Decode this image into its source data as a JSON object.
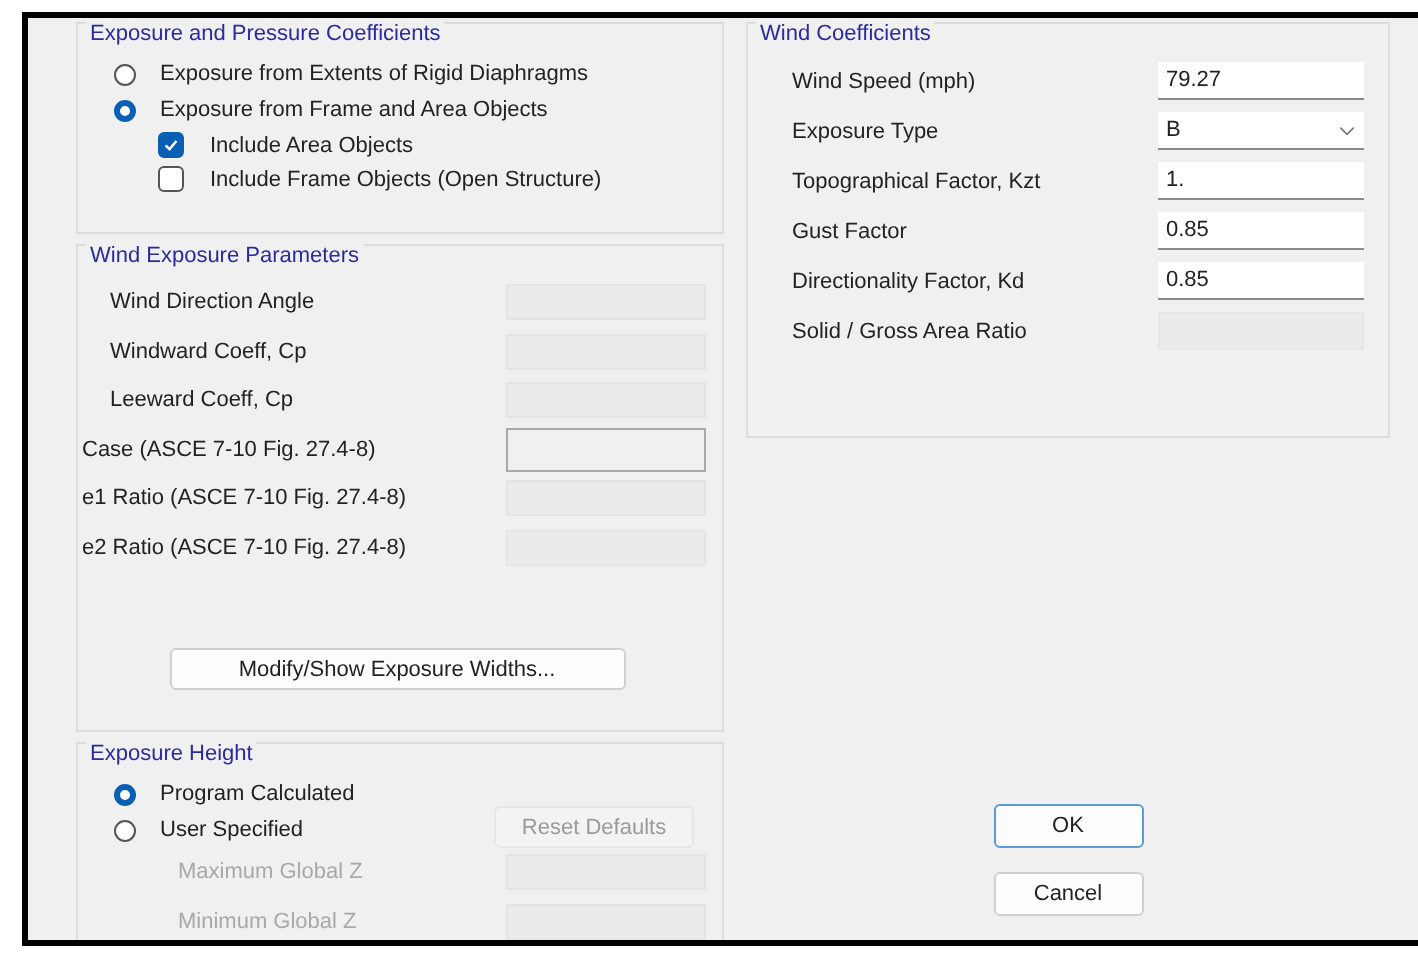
{
  "exposure_pressure": {
    "title": "Exposure and Pressure Coefficients",
    "options": [
      {
        "label": "Exposure from Extents of Rigid Diaphragms",
        "selected": false
      },
      {
        "label": "Exposure from Frame and Area Objects",
        "selected": true
      }
    ],
    "checkboxes": [
      {
        "label": "Include Area Objects",
        "checked": true
      },
      {
        "label": "Include Frame Objects (Open Structure)",
        "checked": false
      }
    ]
  },
  "wind_exposure_parameters": {
    "title": "Wind Exposure Parameters",
    "fields": [
      {
        "label": "Wind Direction Angle",
        "kind": "indented",
        "disabled": true
      },
      {
        "label": "Windward Coeff, Cp",
        "kind": "indented",
        "disabled": true
      },
      {
        "label": "Leeward Coeff, Cp",
        "kind": "indented",
        "disabled": true
      },
      {
        "label": "Case (ASCE 7-10 Fig. 27.4-8)",
        "kind": "plain",
        "disabled": false
      },
      {
        "label": "e1 Ratio  (ASCE 7-10 Fig. 27.4-8)",
        "kind": "plain",
        "disabled": true
      },
      {
        "label": "e2 Ratio  (ASCE 7-10 Fig. 27.4-8)",
        "kind": "plain",
        "disabled": true
      }
    ],
    "button": "Modify/Show Exposure Widths..."
  },
  "exposure_height": {
    "title": "Exposure Height",
    "options": [
      {
        "label": "Program Calculated",
        "selected": true
      },
      {
        "label": "User Specified",
        "selected": false
      }
    ],
    "reset_button": {
      "label": "Reset Defaults",
      "disabled": true
    },
    "fields": [
      {
        "label": "Maximum Global  Z",
        "disabled": true
      },
      {
        "label": "Minimum Global  Z",
        "disabled": true
      }
    ]
  },
  "wind_coefficients": {
    "title": "Wind Coefficients",
    "fields": [
      {
        "label": "Wind Speed (mph)",
        "kind": "text",
        "value": "79.27",
        "disabled": false
      },
      {
        "label": "Exposure Type",
        "kind": "dropdown",
        "value": "B",
        "disabled": false
      },
      {
        "label": "Topographical Factor, Kzt",
        "kind": "text",
        "value": "1.",
        "disabled": false
      },
      {
        "label": "Gust Factor",
        "kind": "text",
        "value": "0.85",
        "disabled": false
      },
      {
        "label": "Directionality Factor, Kd",
        "kind": "text",
        "value": "0.85",
        "disabled": false
      },
      {
        "label": "Solid / Gross Area Ratio",
        "kind": "text",
        "disabled": true
      }
    ]
  },
  "buttons": [
    {
      "label": "OK",
      "default": true
    },
    {
      "label": "Cancel",
      "default": false
    }
  ]
}
